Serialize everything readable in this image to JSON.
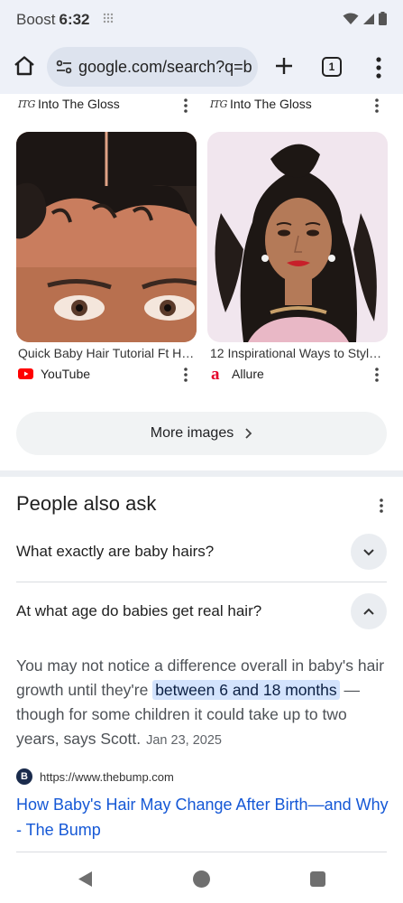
{
  "status_bar": {
    "carrier": "Boost",
    "time": "6:32"
  },
  "toolbar": {
    "url": "google.com/search?q=b",
    "tab_count": "1"
  },
  "image_results": {
    "top_sources": [
      {
        "name": "Into The Gloss",
        "logo": "ITG"
      },
      {
        "name": "Into The Gloss",
        "logo": "ITG"
      }
    ],
    "cards": [
      {
        "caption": "Quick Baby Hair Tutorial Ft Hur...",
        "source": "YouTube",
        "source_icon": "youtube-icon"
      },
      {
        "caption": "12 Inspirational Ways to Style Y...",
        "source": "Allure",
        "source_icon": "allure-icon"
      }
    ],
    "more_label": "More images"
  },
  "people_also_ask": {
    "title": "People also ask",
    "questions": [
      {
        "text": "What exactly are baby hairs?",
        "expanded": false
      },
      {
        "text": "At what age do babies get real hair?",
        "expanded": true
      }
    ],
    "answer": {
      "before": "You may not notice a difference overall in baby's hair growth until they're ",
      "highlight": "between 6 and 18 months",
      "after": " — though for some children it could take up to two years, says Scott.",
      "date": "Jan 23, 2025"
    },
    "citation": {
      "favicon": "B",
      "url": "https://www.thebump.com",
      "title": "How Baby's Hair May Change After Birth—and Why - The Bump"
    }
  },
  "colors": {
    "accent": "#1558d6",
    "highlight": "#d3e3fd",
    "chrome_bg": "#eef1f8"
  }
}
